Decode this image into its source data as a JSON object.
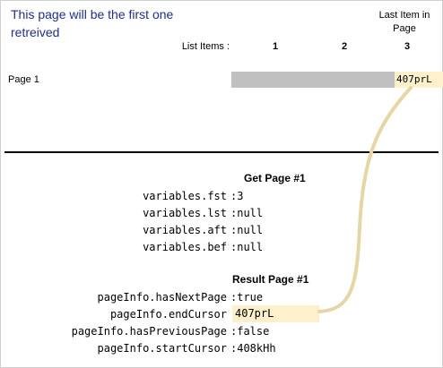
{
  "header": {
    "note_line1": "This page will be the first one",
    "note_line2": "retreived",
    "last_item_line1": "Last Item in",
    "last_item_line2": "Page",
    "list_items_label": "List Items :",
    "columns": [
      "1",
      "2",
      "3"
    ]
  },
  "page_row": {
    "label": "Page 1",
    "cursor": "407prL"
  },
  "get_page": {
    "title": "Get Page #1",
    "variables": [
      {
        "key": "variables.fst",
        "value": "3"
      },
      {
        "key": "variables.lst",
        "value": "null"
      },
      {
        "key": "variables.aft",
        "value": "null"
      },
      {
        "key": "variables.bef",
        "value": "null"
      }
    ]
  },
  "result_page": {
    "title": "Result Page #1",
    "fields": [
      {
        "key": "pageInfo.hasNextPage",
        "value": "true"
      },
      {
        "key": "pageInfo.endCursor",
        "value": "407prL"
      },
      {
        "key": "pageInfo.hasPreviousPage",
        "value": "false"
      },
      {
        "key": "pageInfo.startCursor",
        "value": "408kHh"
      }
    ]
  },
  "colors": {
    "note_text": "#1f2f8a",
    "bar_fill": "#c0c0c0",
    "highlight": "#fdf0cb",
    "connector": "#e6d6a6"
  }
}
